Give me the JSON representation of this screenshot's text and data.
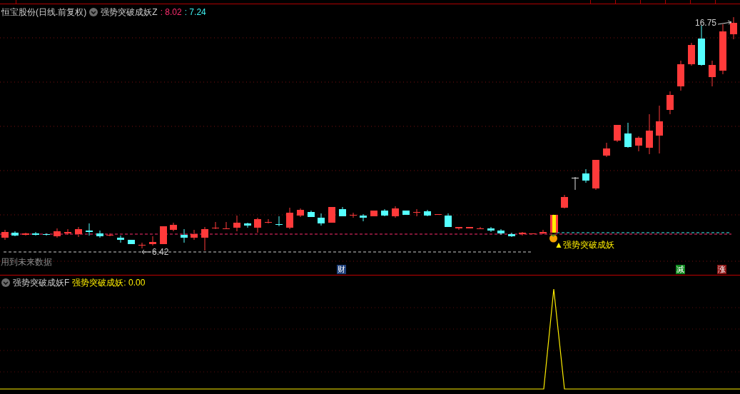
{
  "main_panel": {
    "title": "恒宝股份(日线.前复权)",
    "indicator": "强势突破成妖Z",
    "values": [
      {
        "text": ": 8.02",
        "color": "#ff2d6f"
      },
      {
        "text": ": 7.24",
        "color": "#3ff0f0"
      }
    ],
    "high_label": "16.75",
    "low_label": "6.42",
    "signal_label": "▲强势突破成妖",
    "note": "用到未来数据",
    "markers": [
      {
        "text": "财",
        "color": "#1e3f7a"
      },
      {
        "text": "减",
        "color": "#0f8a1e"
      },
      {
        "text": "涨",
        "color": "#8c1414"
      }
    ]
  },
  "sub_panel": {
    "indicator": "强势突破成妖F",
    "value_text": "强势突破成妖: 0.00"
  }
}
